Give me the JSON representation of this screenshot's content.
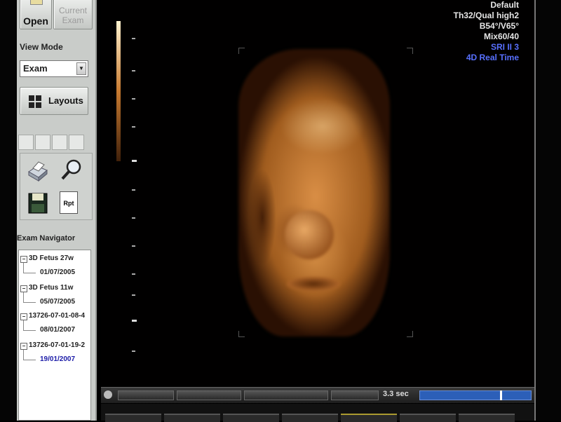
{
  "toolbar": {
    "open_label": "Open",
    "current_exam_line1": "Current",
    "current_exam_line2": "Exam"
  },
  "view_mode": {
    "title": "View Mode",
    "selected": "Exam",
    "layouts_label": "Layouts"
  },
  "tools": {
    "icons": [
      "print-icon",
      "magnifier-icon",
      "save-icon",
      "report-icon"
    ],
    "report_icon_text": "Rpt"
  },
  "exam_navigator": {
    "title": "Exam Navigator",
    "items": [
      {
        "name": "3D Fetus 27w",
        "date": "01/07/2005",
        "selected": false
      },
      {
        "name": "3D Fetus 11w",
        "date": "05/07/2005",
        "selected": false
      },
      {
        "name": "13726-07-01-08-4",
        "date": "08/01/2007",
        "selected": false
      },
      {
        "name": "13726-07-01-19-2",
        "date": "19/01/2007",
        "selected": true
      }
    ]
  },
  "image_info": {
    "line1": "Default",
    "line2": "Th32/Qual high2",
    "line3": "B54°/V65°",
    "line4": "Mix60/40",
    "line5": "SRI II 3",
    "line6": "4D Real Time"
  },
  "playback": {
    "time_label": "3.3 sec",
    "progress": 0.72
  },
  "colors": {
    "sidebar_bg": "#c9ccc9",
    "selected_text": "#1c1ca8",
    "progress_blue": "#2c5fb8",
    "info_blue": "#5870ff"
  }
}
